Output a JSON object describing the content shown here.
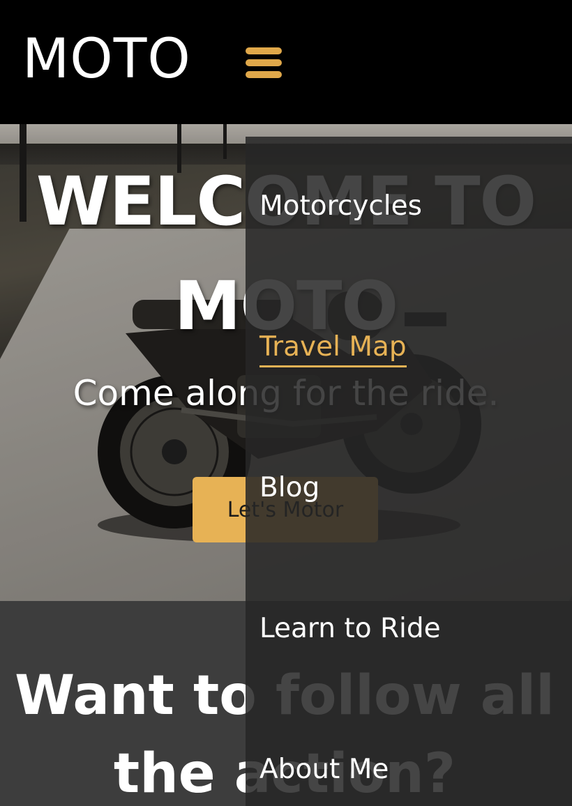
{
  "header": {
    "logo": "MOTO",
    "menu_icon": "hamburger-menu-icon"
  },
  "hero": {
    "title": "WELCOME TO MOTO",
    "subtitle": "Come along for the ride.",
    "cta_label": "Let's Motor"
  },
  "lower": {
    "heading": "Want to follow all the action?"
  },
  "nav": {
    "items": [
      {
        "label": "Motorcycles",
        "active": false
      },
      {
        "label": "Travel Map",
        "active": true
      },
      {
        "label": "Blog",
        "active": false
      },
      {
        "label": "Learn to Ride",
        "active": false
      },
      {
        "label": "About Me",
        "active": false
      }
    ]
  },
  "colors": {
    "accent": "#e7b255",
    "header_bg": "#000000",
    "nav_overlay": "#262626",
    "lower_bg": "#3d3d3d"
  }
}
